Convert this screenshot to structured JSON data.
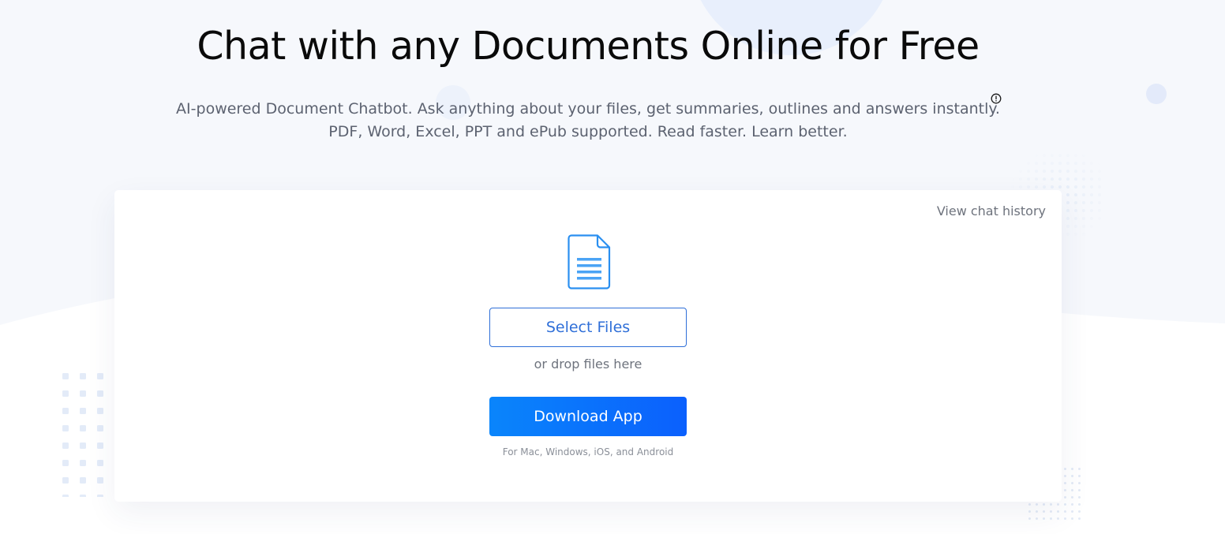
{
  "hero": {
    "title": "Chat with any Documents Online for Free",
    "subtitle_line1": "AI-powered Document Chatbot. Ask anything about your files, get summaries, outlines and answers instantly.",
    "subtitle_line2": "PDF, Word, Excel, PPT and ePub supported. Read faster. Learn better.",
    "info_icon": "info-circle-icon"
  },
  "upload_card": {
    "history_link": "View chat history",
    "document_icon": "document-icon",
    "select_button": "Select Files",
    "drop_hint": "or drop files here",
    "download_button": "Download App",
    "platform_note": "For Mac, Windows, iOS, and Android"
  },
  "colors": {
    "background": "#f6f8fc",
    "accent_blue": "#2f6fd8",
    "download_gradient_start": "#0a85fb",
    "download_gradient_end": "#0b60fd",
    "icon_blue": "#2a8ff0",
    "muted_text": "#6e737d"
  }
}
